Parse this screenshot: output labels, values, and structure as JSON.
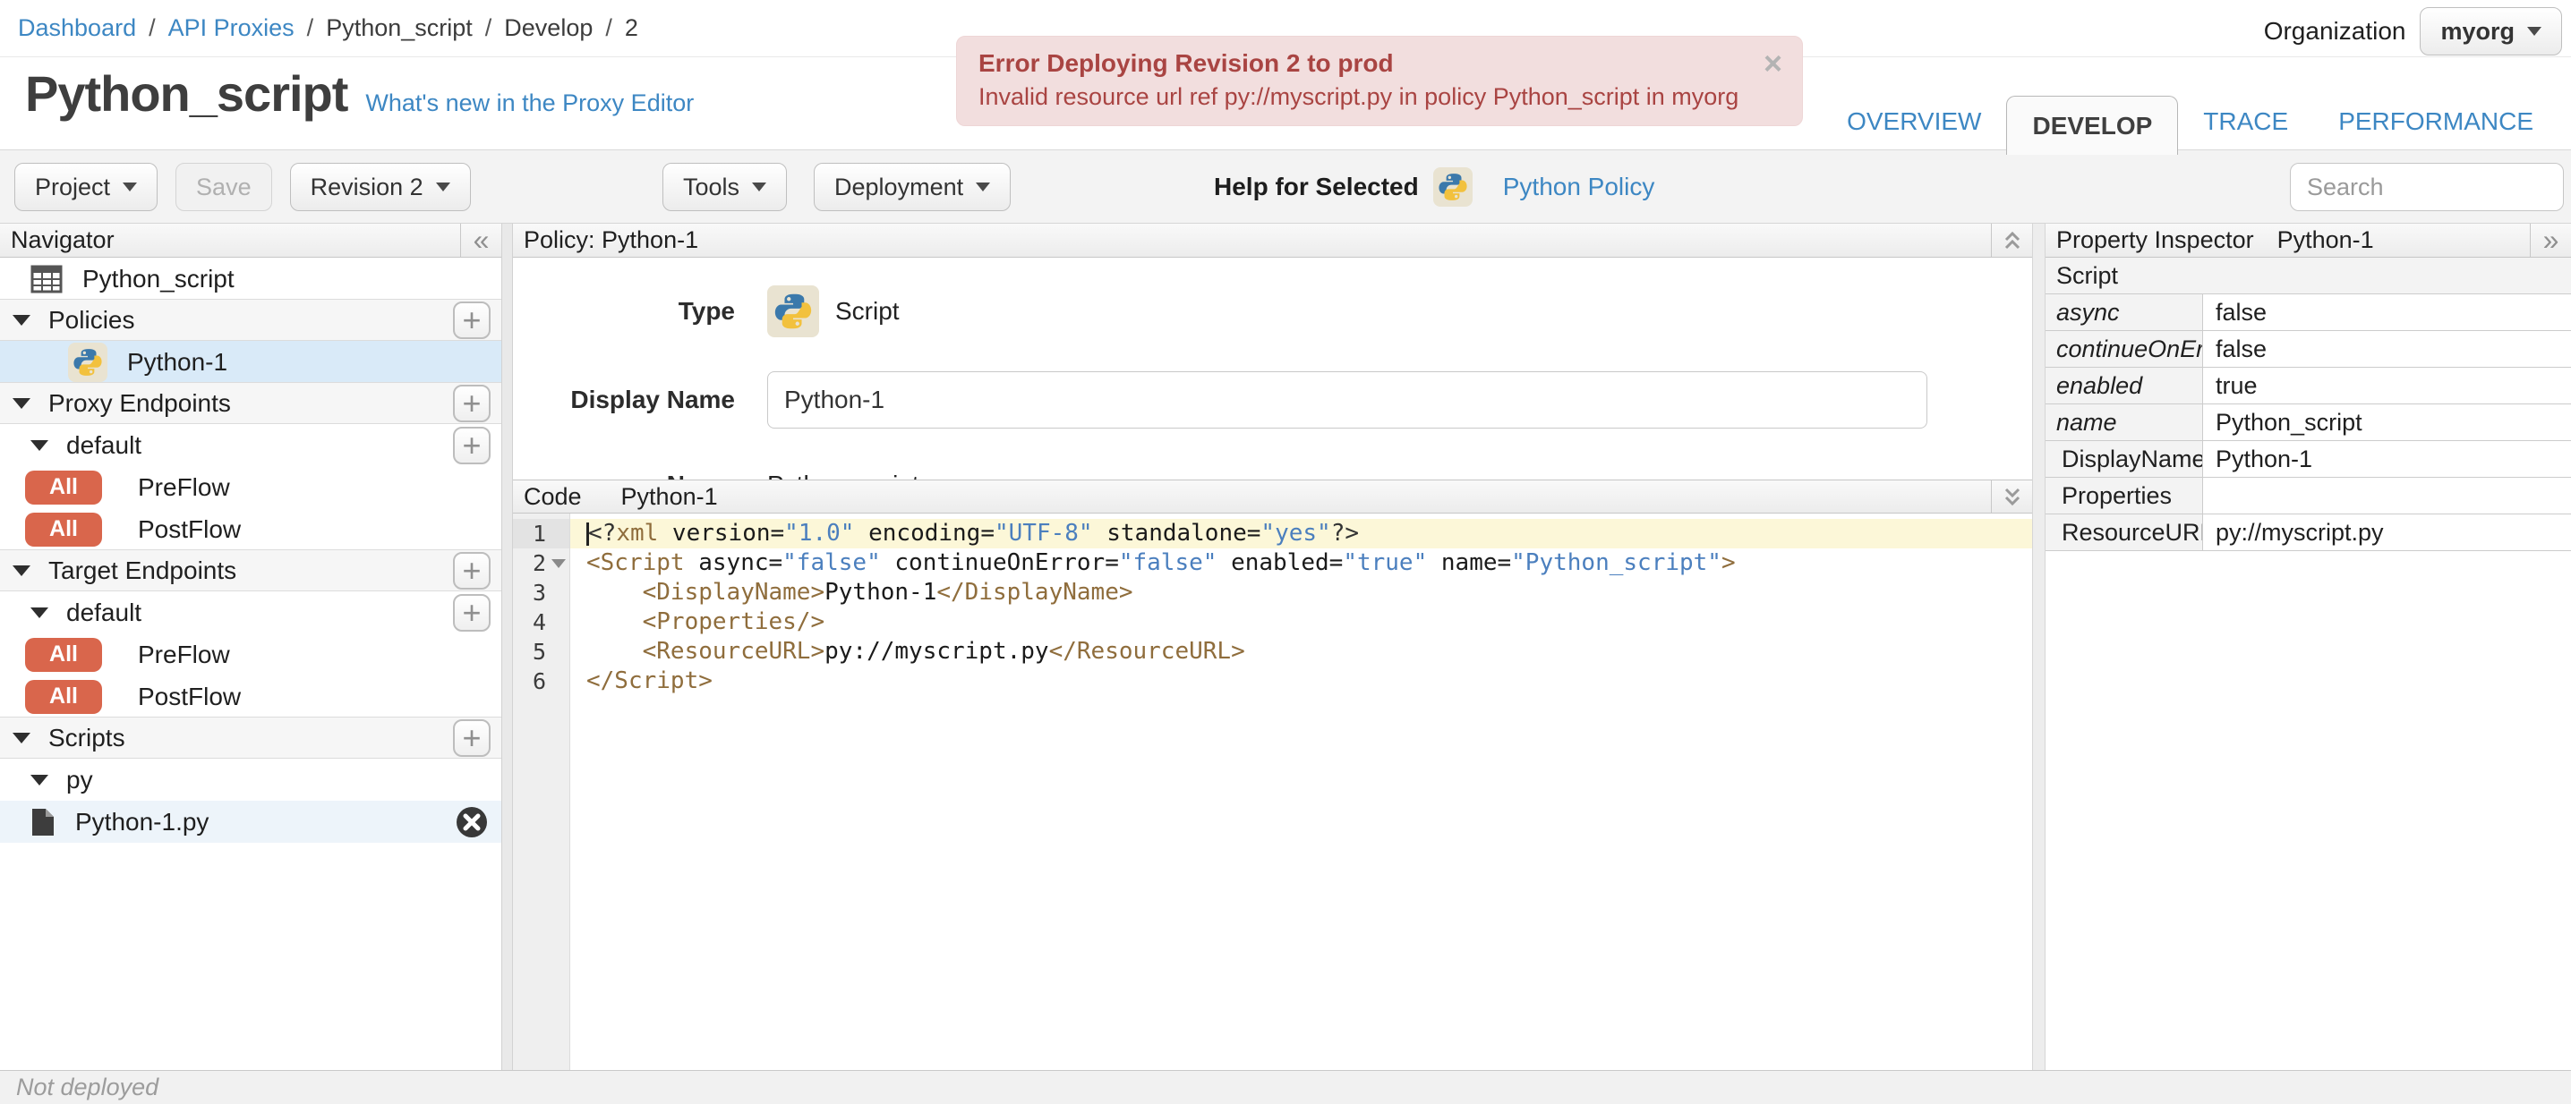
{
  "breadcrumb": {
    "separator": "/",
    "items": [
      {
        "label": "Dashboard",
        "link": true
      },
      {
        "label": "API Proxies",
        "link": true
      },
      {
        "label": "Python_script",
        "link": false
      },
      {
        "label": "Develop",
        "link": false
      },
      {
        "label": "2",
        "link": false
      }
    ]
  },
  "organization": {
    "label": "Organization",
    "value": "myorg"
  },
  "error_banner": {
    "title": "Error Deploying Revision 2 to prod",
    "message": "Invalid resource url ref py://myscript.py in policy Python_script in myorg",
    "close_icon": "×"
  },
  "page": {
    "title": "Python_script",
    "whats_new_link": "What's new in the Proxy Editor"
  },
  "tabs": [
    {
      "label": "OVERVIEW",
      "active": false
    },
    {
      "label": "DEVELOP",
      "active": true
    },
    {
      "label": "TRACE",
      "active": false
    },
    {
      "label": "PERFORMANCE",
      "active": false
    }
  ],
  "toolbar": {
    "project": "Project",
    "save": "Save",
    "revision": "Revision 2",
    "tools": "Tools",
    "deployment": "Deployment",
    "help_for_selected": "Help for Selected",
    "policy_help_link": "Python Policy",
    "search_placeholder": "Search"
  },
  "icons": {
    "navigator_collapse": "«",
    "property_expand": "»",
    "add": "+"
  },
  "navigator": {
    "title": "Navigator",
    "items": [
      {
        "type": "item",
        "icon": "bundle",
        "label": "Python_script"
      },
      {
        "type": "section",
        "caret": true,
        "label": "Policies",
        "add": true
      },
      {
        "type": "item",
        "icon": "python",
        "label": "Python-1",
        "lvl2": true,
        "selected": true
      },
      {
        "type": "section",
        "caret": true,
        "label": "Proxy Endpoints",
        "add": true
      },
      {
        "type": "subsection",
        "caret": true,
        "label": "default",
        "add": true
      },
      {
        "type": "flow",
        "badge": "All",
        "label": "PreFlow"
      },
      {
        "type": "flow",
        "badge": "All",
        "label": "PostFlow"
      },
      {
        "type": "section",
        "caret": true,
        "label": "Target Endpoints",
        "add": true
      },
      {
        "type": "subsection",
        "caret": true,
        "label": "default",
        "add": true
      },
      {
        "type": "flow",
        "badge": "All",
        "label": "PreFlow"
      },
      {
        "type": "flow",
        "badge": "All",
        "label": "PostFlow"
      },
      {
        "type": "section",
        "caret": true,
        "label": "Scripts",
        "add": true
      },
      {
        "type": "subsection",
        "caret": true,
        "label": "py"
      },
      {
        "type": "item",
        "icon": "file",
        "label": "Python-1.py",
        "highlight": true,
        "del": true
      }
    ]
  },
  "policy_panel": {
    "header": "Policy: Python-1",
    "type_label": "Type",
    "type_value": "Script",
    "display_name_label": "Display Name",
    "display_name_value": "Python-1",
    "name_label": "Name",
    "name_value": "Python_script"
  },
  "code_panel": {
    "header_label": "Code",
    "header_file": "Python-1",
    "lines": [
      {
        "no": 1,
        "active": true,
        "tokens": [
          {
            "c": "meta",
            "s": "<?"
          },
          {
            "c": "tag",
            "s": "xml"
          },
          {
            "c": "plain",
            "s": " version="
          },
          {
            "c": "str",
            "s": "\"1.0\""
          },
          {
            "c": "plain",
            "s": " encoding="
          },
          {
            "c": "str",
            "s": "\"UTF-8\""
          },
          {
            "c": "plain",
            "s": " standalone="
          },
          {
            "c": "str",
            "s": "\"yes\""
          },
          {
            "c": "meta",
            "s": "?>"
          }
        ]
      },
      {
        "no": 2,
        "fold": true,
        "tokens": [
          {
            "c": "tag",
            "s": "<Script"
          },
          {
            "c": "plain",
            "s": " async="
          },
          {
            "c": "str",
            "s": "\"false\""
          },
          {
            "c": "plain",
            "s": " continueOnError="
          },
          {
            "c": "str",
            "s": "\"false\""
          },
          {
            "c": "plain",
            "s": " enabled="
          },
          {
            "c": "str",
            "s": "\"true\""
          },
          {
            "c": "plain",
            "s": " name="
          },
          {
            "c": "str",
            "s": "\"Python_script\""
          },
          {
            "c": "tag",
            "s": ">"
          }
        ]
      },
      {
        "no": 3,
        "tokens": [
          {
            "c": "plain",
            "s": "    "
          },
          {
            "c": "tag",
            "s": "<DisplayName>"
          },
          {
            "c": "plain",
            "s": "Python-1"
          },
          {
            "c": "tag",
            "s": "</DisplayName>"
          }
        ]
      },
      {
        "no": 4,
        "tokens": [
          {
            "c": "plain",
            "s": "    "
          },
          {
            "c": "tag",
            "s": "<Properties/>"
          }
        ]
      },
      {
        "no": 5,
        "tokens": [
          {
            "c": "plain",
            "s": "    "
          },
          {
            "c": "tag",
            "s": "<ResourceURL>"
          },
          {
            "c": "plain",
            "s": "py://myscript.py"
          },
          {
            "c": "tag",
            "s": "</ResourceURL>"
          }
        ]
      },
      {
        "no": 6,
        "tokens": [
          {
            "c": "tag",
            "s": "</Script>"
          }
        ]
      }
    ]
  },
  "property_inspector": {
    "title": "Property Inspector",
    "subject": "Python-1",
    "section": "Script",
    "rows": [
      {
        "label": "async",
        "value": "false",
        "italic": true
      },
      {
        "label": "continueOnError",
        "value": "false",
        "italic": true
      },
      {
        "label": "enabled",
        "value": "true",
        "italic": true
      },
      {
        "label": "name",
        "value": "Python_script",
        "italic": true
      },
      {
        "label": "DisplayName",
        "value": "Python-1",
        "italic": false
      },
      {
        "label": "Properties",
        "value": "",
        "italic": false
      },
      {
        "label": "ResourceURL",
        "value": "py://myscript.py",
        "italic": false
      }
    ]
  },
  "status_bar": {
    "text": "Not deployed"
  },
  "colors": {
    "link_blue": "#3d87c3",
    "error_red": "#a94442",
    "error_bg": "#f2dede",
    "badge_orange": "#d9664c",
    "selection_blue": "#d9eaf8",
    "code_tag": "#8f6d3c",
    "code_string": "#4b7fbe",
    "active_line_bg": "#fcf7d8"
  }
}
